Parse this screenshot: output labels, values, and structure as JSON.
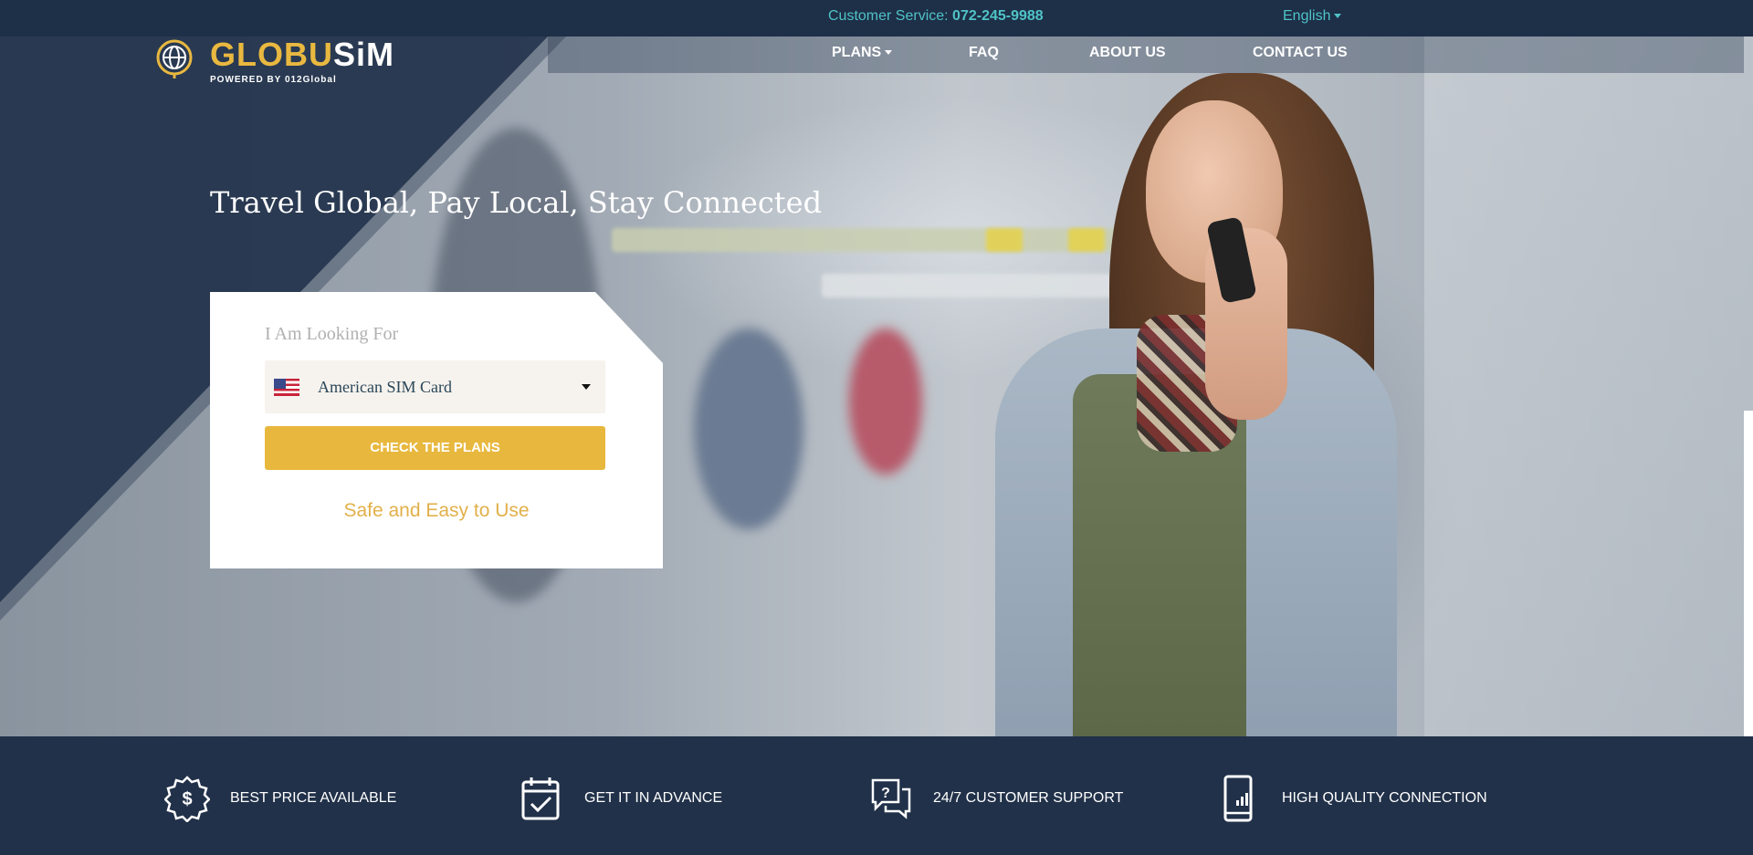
{
  "header": {
    "customer_service_label": "Customer Service:",
    "customer_service_phone": "072-245-9988",
    "language": "English",
    "logo_text_a": "GLOBU",
    "logo_text_b": "SiM",
    "logo_sub": "POWERED BY 012Global",
    "nav": [
      "PLANS",
      "FAQ",
      "ABOUT US",
      "CONTACT US"
    ]
  },
  "hero": {
    "headline": "Travel Global, Pay Local, Stay Connected"
  },
  "search": {
    "label": "I Am Looking For",
    "selected": "American SIM Card",
    "flag": "us-flag-icon",
    "button": "CHECK THE PLANS",
    "tagline": "Safe and Easy to Use"
  },
  "features": [
    {
      "icon": "price-badge-icon",
      "label": "BEST PRICE AVAILABLE"
    },
    {
      "icon": "calendar-check-icon",
      "label": "GET IT IN ADVANCE"
    },
    {
      "icon": "chat-question-icon",
      "label": "24/7 CUSTOMER SUPPORT"
    },
    {
      "icon": "phone-signal-icon",
      "label": "HIGH QUALITY CONNECTION"
    }
  ],
  "colors": {
    "navy": "#1e2f48",
    "gold": "#e8b83e",
    "teal": "#4fc3c6"
  }
}
